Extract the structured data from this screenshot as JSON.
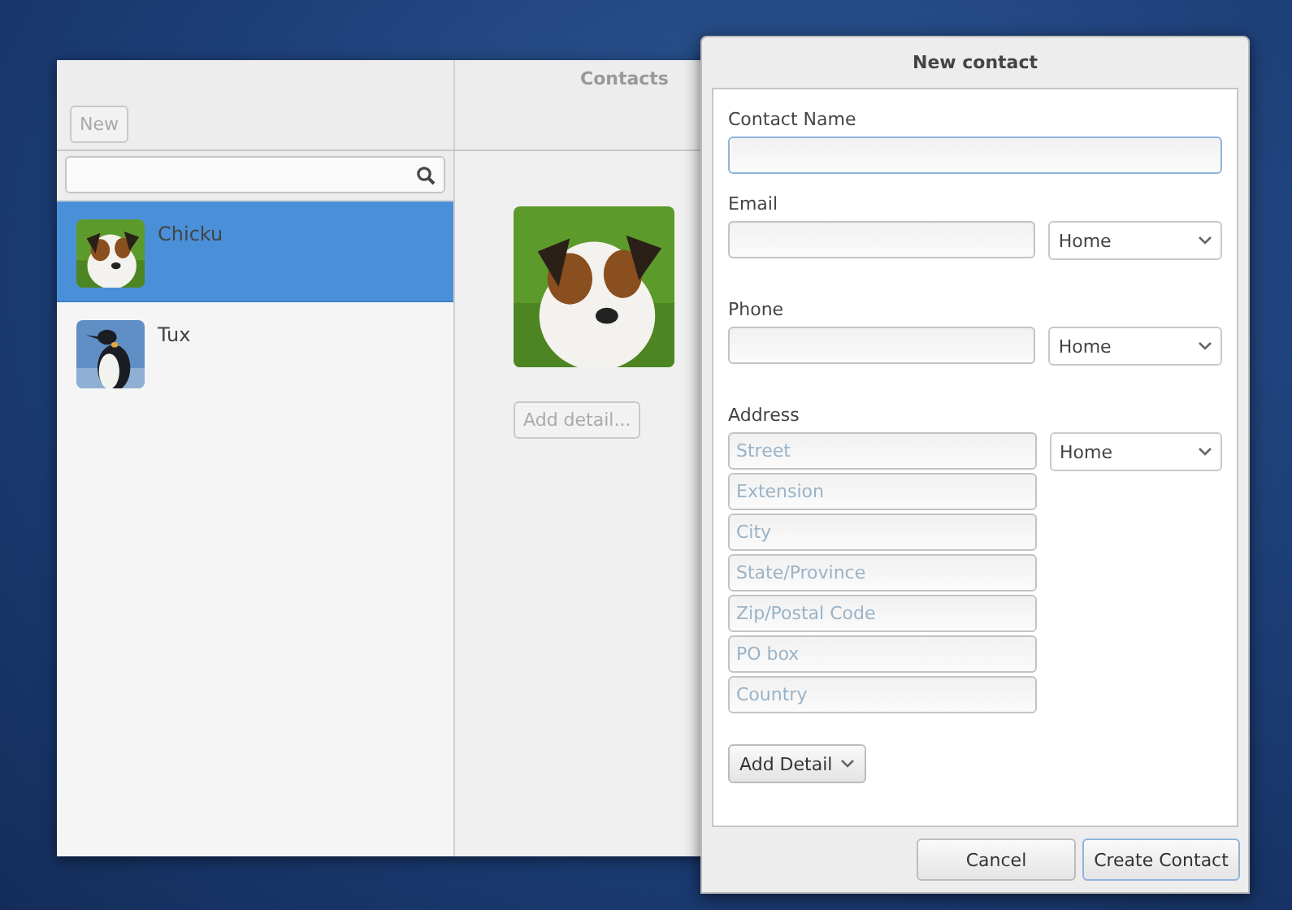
{
  "main_window": {
    "title": "Contacts",
    "new_button": "New",
    "contacts": [
      {
        "name": "Chicku",
        "selected": true
      },
      {
        "name": "Tux",
        "selected": false
      }
    ],
    "detail": {
      "add_detail_button": "Add detail..."
    }
  },
  "dialog": {
    "title": "New contact",
    "contact_name": {
      "label": "Contact Name",
      "focused": true
    },
    "email": {
      "label": "Email",
      "type": "Home"
    },
    "phone": {
      "label": "Phone",
      "type": "Home"
    },
    "address": {
      "label": "Address",
      "type": "Home",
      "fields": [
        {
          "placeholder": "Street"
        },
        {
          "placeholder": "Extension"
        },
        {
          "placeholder": "City"
        },
        {
          "placeholder": "State/Province"
        },
        {
          "placeholder": "Zip/Postal Code"
        },
        {
          "placeholder": "PO box"
        },
        {
          "placeholder": "Country"
        }
      ]
    },
    "add_detail_button": "Add Detail",
    "buttons": [
      {
        "label": "Cancel",
        "default": false
      },
      {
        "label": "Create Contact",
        "default": true
      }
    ]
  }
}
